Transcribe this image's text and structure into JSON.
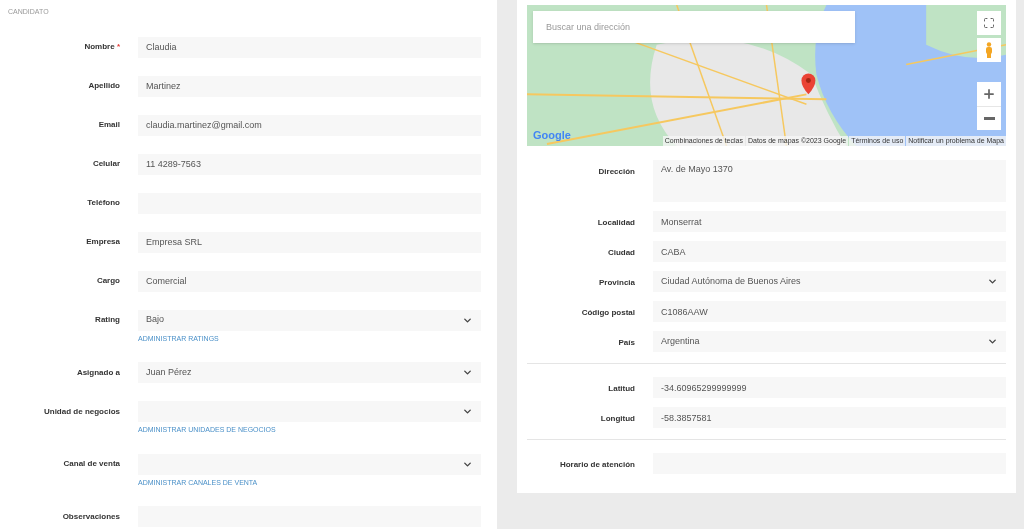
{
  "section_title": "CANDIDATO",
  "candidate_fields": [
    {
      "label": "Nombre",
      "mark": "*",
      "kind": "text",
      "value": "Claudia"
    },
    {
      "label": "Apellido",
      "kind": "text",
      "value": "Martinez"
    },
    {
      "label": "Email",
      "kind": "text",
      "value": "claudia.martinez@gmail.com"
    },
    {
      "label": "Celular",
      "kind": "text",
      "value": "11 4289-7563"
    },
    {
      "label": "Teléfono",
      "kind": "text"
    },
    {
      "label": "Empresa",
      "kind": "text",
      "value": "Empresa SRL"
    },
    {
      "label": "Cargo",
      "kind": "text",
      "value": "Comercial"
    },
    {
      "label": "Rating",
      "kind": "select",
      "value": "Bajo",
      "link": "ADMINISTRAR RATINGS"
    },
    {
      "label": "Asignado a",
      "kind": "select",
      "value": "Juan Pérez"
    },
    {
      "label": "Unidad de negocios",
      "kind": "select",
      "link": "ADMINISTRAR UNIDADES DE NEGOCIOS"
    },
    {
      "label": "Canal de venta",
      "kind": "select",
      "link": "ADMINISTRAR CANALES DE VENTA"
    },
    {
      "label": "Observaciones",
      "kind": "text"
    }
  ],
  "map": {
    "search_placeholder": "Buscar una dirección",
    "logo": "Google",
    "attributions": [
      "Combinaciones de teclas",
      "Datos de mapas ©2023 Google",
      "Términos de uso",
      "Notificar un problema de Mapa"
    ]
  },
  "address_groups": [
    [
      {
        "label": "Dirección",
        "kind": "textarea",
        "value": "Av. de Mayo 1370"
      },
      {
        "label": "Localidad",
        "kind": "text",
        "value": "Monserrat"
      },
      {
        "label": "Ciudad",
        "kind": "text",
        "value": "CABA"
      },
      {
        "label": "Provincia",
        "kind": "select",
        "value": "Ciudad Autónoma de Buenos Aires"
      },
      {
        "label": "Código postal",
        "kind": "text",
        "value": "C1086AAW"
      },
      {
        "label": "País",
        "kind": "select",
        "value": "Argentina"
      }
    ],
    [
      {
        "label": "Latitud",
        "kind": "text",
        "value": "-34.60965299999999"
      },
      {
        "label": "Longitud",
        "kind": "text",
        "value": "-58.3857581"
      }
    ],
    [
      {
        "label": "Horario de atención",
        "kind": "text"
      }
    ]
  ]
}
